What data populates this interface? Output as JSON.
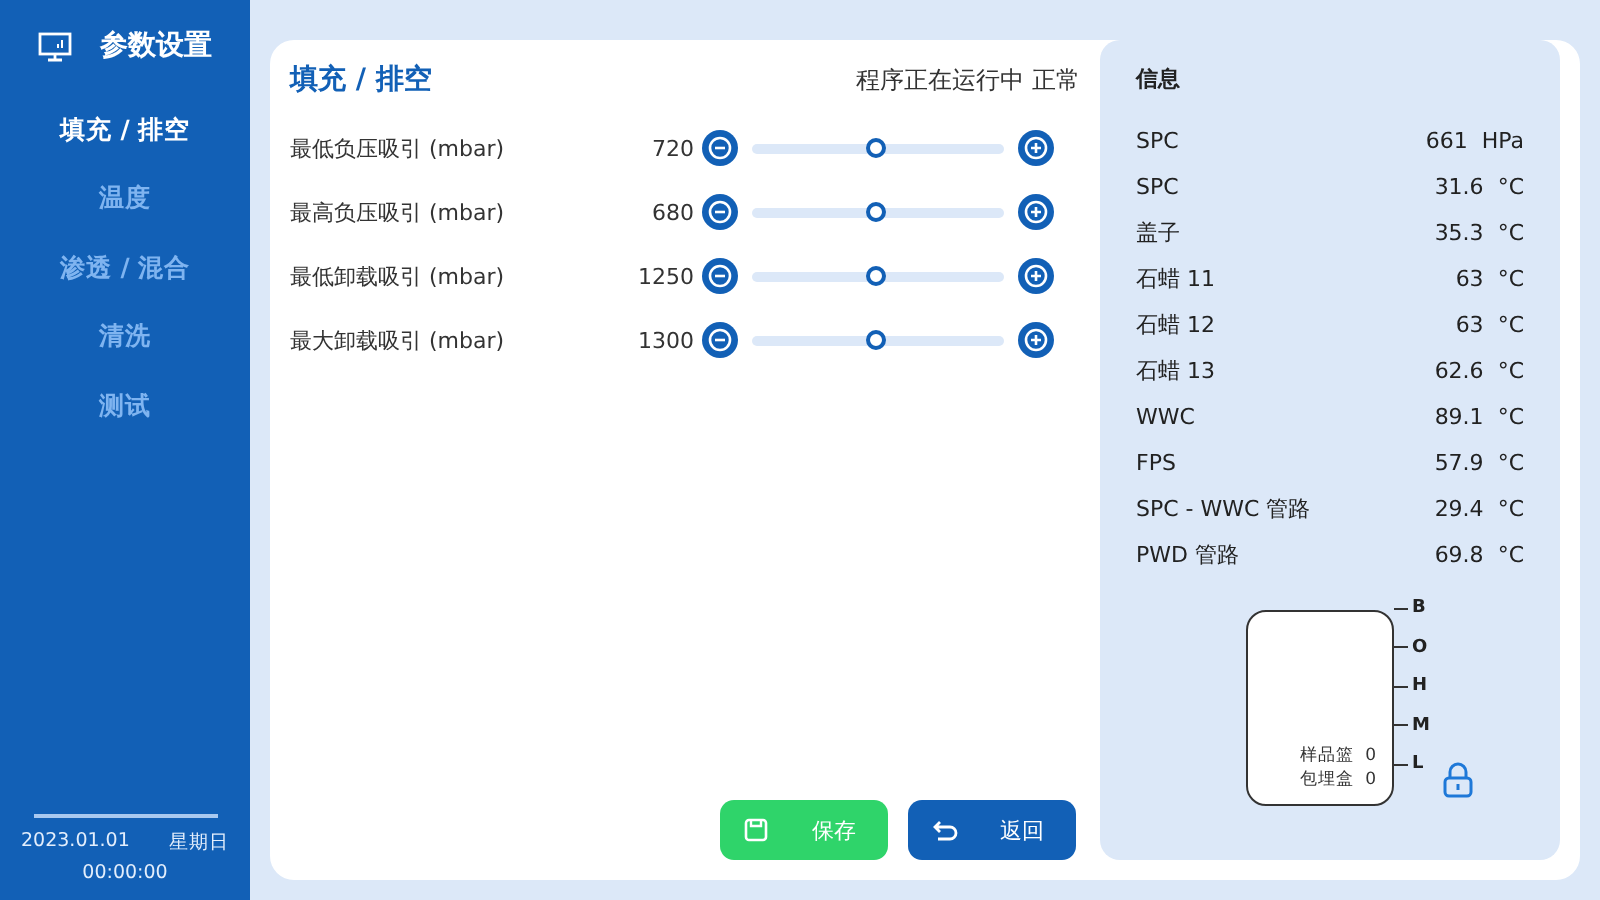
{
  "sidebar": {
    "title": "参数设置",
    "items": [
      {
        "label": "填充 / 排空",
        "selected": true
      },
      {
        "label": "温度",
        "selected": false
      },
      {
        "label": "渗透 / 混合",
        "selected": false
      },
      {
        "label": "清洗",
        "selected": false
      },
      {
        "label": "测试",
        "selected": false
      }
    ],
    "date": "2023.01.01",
    "weekday": "星期日",
    "time": "00:00:00"
  },
  "settings": {
    "title": "填充 / 排空",
    "status": "程序正在运行中",
    "state": "正常",
    "rows": [
      {
        "label": "最低负压吸引 (mbar)",
        "value": "720",
        "level": 0.49
      },
      {
        "label": "最高负压吸引 (mbar)",
        "value": "680",
        "level": 0.49
      },
      {
        "label": "最低卸载吸引 (mbar)",
        "value": "1250",
        "level": 0.49
      },
      {
        "label": "最大卸载吸引 (mbar)",
        "value": "1300",
        "level": 0.49
      }
    ],
    "buttons": [
      {
        "kind": "save",
        "label": "保存"
      },
      {
        "kind": "back",
        "label": "返回"
      }
    ]
  },
  "info": {
    "title": "信息",
    "rows": [
      {
        "name": "SPC",
        "value": "661",
        "unit": "HPa"
      },
      {
        "name": "SPC",
        "value": "31.6",
        "unit": "°C"
      },
      {
        "name": "盖子",
        "value": "35.3",
        "unit": "°C"
      },
      {
        "name": "石蜡 11",
        "value": "63",
        "unit": "°C"
      },
      {
        "name": "石蜡 12",
        "value": "63",
        "unit": "°C"
      },
      {
        "name": "石蜡 13",
        "value": "62.6",
        "unit": "°C"
      },
      {
        "name": "WWC",
        "value": "89.1",
        "unit": "°C"
      },
      {
        "name": "FPS",
        "value": "57.9",
        "unit": "°C"
      },
      {
        "name": "SPC - WWC 管路",
        "value": "29.4",
        "unit": "°C"
      },
      {
        "name": "PWD 管路",
        "value": "69.8",
        "unit": "°C"
      }
    ],
    "tank": {
      "levels": [
        "B",
        "O",
        "H",
        "M",
        "L"
      ],
      "counts": [
        {
          "label": "样品篮",
          "value": "0"
        },
        {
          "label": "包埋盒",
          "value": "0"
        }
      ],
      "locked": true
    }
  }
}
